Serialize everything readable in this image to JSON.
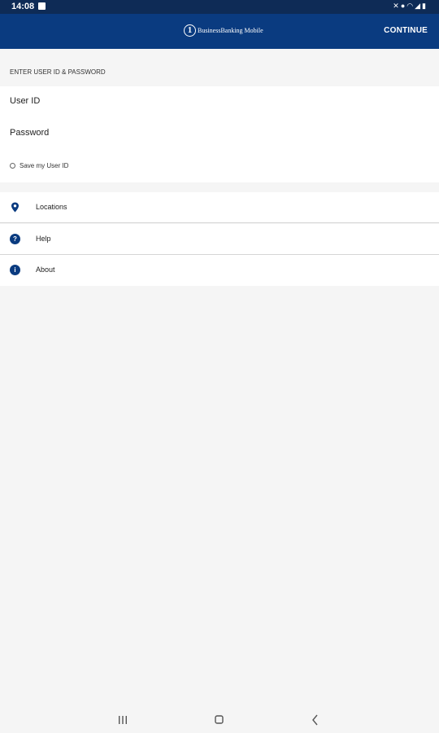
{
  "status_bar": {
    "time": "14:08",
    "icons": [
      "mute-icon",
      "location-icon",
      "wifi-icon",
      "signal-icon",
      "battery-icon"
    ]
  },
  "header": {
    "logo_badge": "1",
    "logo_text": "BusinessBanking Mobile",
    "continue_label": "CONTINUE"
  },
  "login": {
    "section_title": "ENTER USER ID & PASSWORD",
    "user_id_placeholder": "User ID",
    "password_placeholder": "Password",
    "save_user_id_label": "Save my User ID",
    "save_user_id_checked": false
  },
  "menu": {
    "items": [
      {
        "label": "Locations",
        "icon": "location-pin-icon"
      },
      {
        "label": "Help",
        "icon": "help-icon",
        "glyph": "?"
      },
      {
        "label": "About",
        "icon": "info-icon",
        "glyph": "i"
      }
    ]
  },
  "colors": {
    "status_bar": "#0e2b56",
    "app_bar": "#0a3b80",
    "accent": "#0a3b80",
    "background": "#f5f5f5"
  },
  "nav_bar": {
    "buttons": [
      "recent-apps-icon",
      "home-icon",
      "back-icon"
    ]
  }
}
